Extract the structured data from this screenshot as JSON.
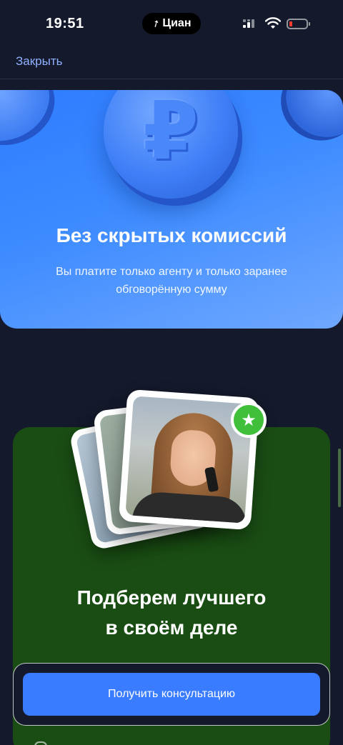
{
  "status_bar": {
    "time": "19:51",
    "app_name": "Циан",
    "icons": [
      "signal-icon",
      "wifi-icon",
      "battery-icon"
    ],
    "battery_color": "#ff3b30"
  },
  "nav": {
    "close_label": "Закрыть"
  },
  "commission_card": {
    "title": "Без скрытых комиссий",
    "description": "Вы платите только агенту и только заранее обговорённую сумму",
    "icon": "ruble-coin-icon",
    "ruble_glyph": "₽",
    "background": "#2f7cff"
  },
  "agent_card": {
    "title_line1": "Подберем лучшего",
    "title_line2": "в своём деле",
    "badge_icon": "star-icon",
    "badge_glyph": "★",
    "background": "#1a4d14"
  },
  "cta": {
    "label": "Получить консультацию",
    "color": "#3a7cff"
  }
}
